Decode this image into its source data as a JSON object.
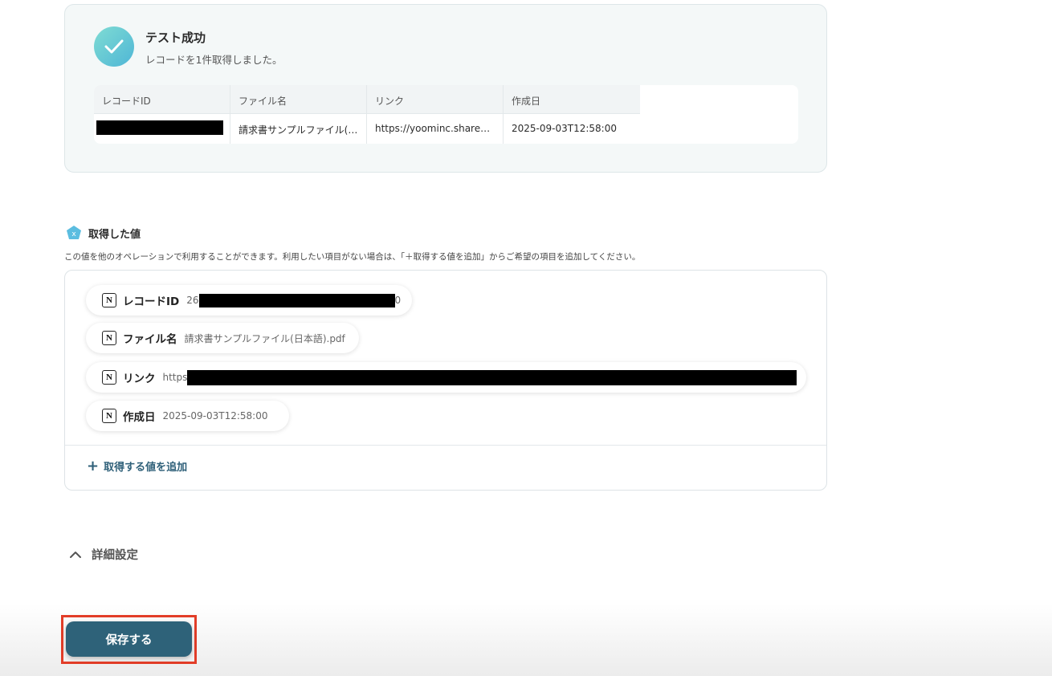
{
  "test_result": {
    "title": "テスト成功",
    "subtitle": "レコードを1件取得しました。",
    "columns": [
      "レコードID",
      "ファイル名",
      "リンク",
      "作成日"
    ],
    "row": {
      "record_id": "",
      "file_name": "請求書サンプルファイル(…",
      "link": "https://yoominc.share…",
      "created": "2025-09-03T12:58:00"
    },
    "icon": "check-icon"
  },
  "values_section": {
    "title": "取得した値",
    "description": "この値を他のオペレーションで利用することができます。利用したい項目がない場合は、「＋取得する値を追加」からご希望の項目を追加してください。",
    "icon": "variable-x-icon",
    "items": [
      {
        "label": "レコードID",
        "value_prefix": "26",
        "value_suffix": "0",
        "icon": "notion-icon"
      },
      {
        "label": "ファイル名",
        "value": "請求書サンプルファイル(日本語).pdf",
        "icon": "notion-icon"
      },
      {
        "label": "リンク",
        "value_prefix": "https",
        "icon": "notion-icon"
      },
      {
        "label": "作成日",
        "value": "2025-09-03T12:58:00",
        "icon": "notion-icon"
      }
    ],
    "add_label": "取得する値を追加"
  },
  "details": {
    "label": "詳細設定",
    "icon": "chevron-up-icon"
  },
  "save_button": {
    "label": "保存する"
  },
  "colors": {
    "primary": "#2e6279",
    "highlight": "#e23d28",
    "success_gradient_start": "#7fdcd3",
    "success_gradient_end": "#4fb6d6"
  }
}
